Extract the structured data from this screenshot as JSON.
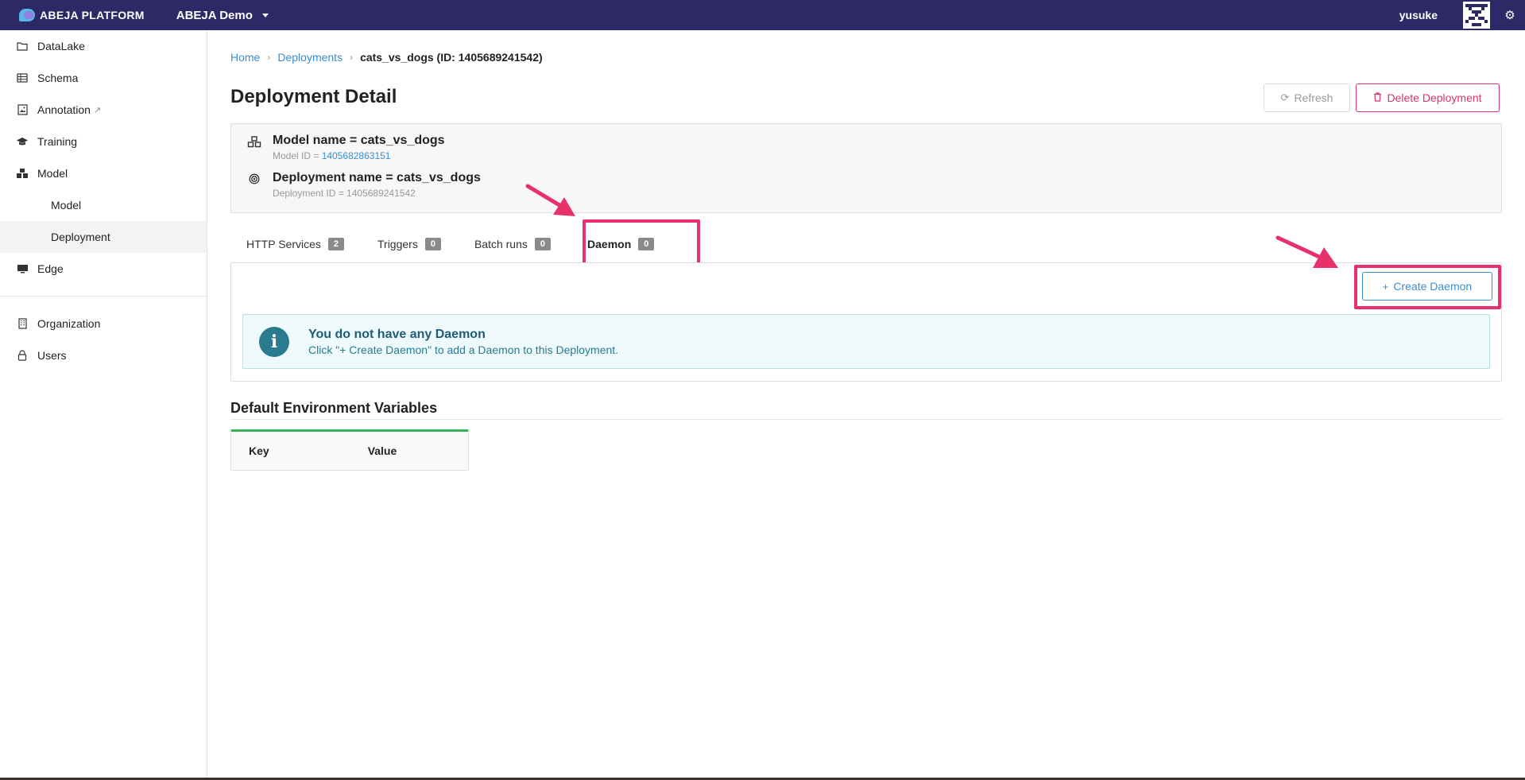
{
  "topbar": {
    "brand": "ABEJA PLATFORM",
    "org_name": "ABEJA Demo",
    "username": "yusuke",
    "icons": [
      "chevron-down-icon",
      "avatar-identicon",
      "gear-icon"
    ]
  },
  "sidebar": {
    "items": [
      {
        "label": "DataLake",
        "icon": "folder-icon"
      },
      {
        "label": "Schema",
        "icon": "table-icon"
      },
      {
        "label": "Annotation",
        "icon": "image-icon"
      },
      {
        "label": "Training",
        "icon": "graduation-cap-icon"
      },
      {
        "label": "Model",
        "icon": "cubes-icon"
      },
      {
        "label": "Model",
        "icon": ""
      },
      {
        "label": "Deployment",
        "icon": ""
      },
      {
        "label": "Edge",
        "icon": "monitor-icon"
      },
      {
        "label": "Organization",
        "icon": "building-icon"
      },
      {
        "label": "Users",
        "icon": "user-icon"
      }
    ]
  },
  "breadcrumb": {
    "home": "Home",
    "deployments": "Deployments",
    "current": "cats_vs_dogs (ID: 1405689241542)"
  },
  "page": {
    "title": "Deployment Detail",
    "refresh_label": "Refresh",
    "delete_label": "Delete Deployment"
  },
  "info": {
    "model_name": "Model name = cats_vs_dogs",
    "model_id_label": "Model ID = ",
    "model_id": "1405682863151",
    "deployment_name": "Deployment name = cats_vs_dogs",
    "deployment_id": "Deployment ID = 1405689241542"
  },
  "tabs": [
    {
      "label": "HTTP Services",
      "count": "2"
    },
    {
      "label": "Triggers",
      "count": "0"
    },
    {
      "label": "Batch runs",
      "count": "0"
    },
    {
      "label": "Daemon",
      "count": "0"
    }
  ],
  "daemon": {
    "create_label": "Create Daemon",
    "empty_title": "You do not have any Daemon",
    "empty_text": "Click \"+ Create Daemon\" to add a Daemon to this Deployment."
  },
  "env": {
    "title": "Default Environment Variables",
    "headers": [
      "Key",
      "Value"
    ]
  },
  "colors": {
    "topbar": "#2d2966",
    "link": "#3a8ecf",
    "danger": "#d6336c",
    "highlight": "#e8306a",
    "success": "#33b35a",
    "info": "#2a7a90"
  }
}
